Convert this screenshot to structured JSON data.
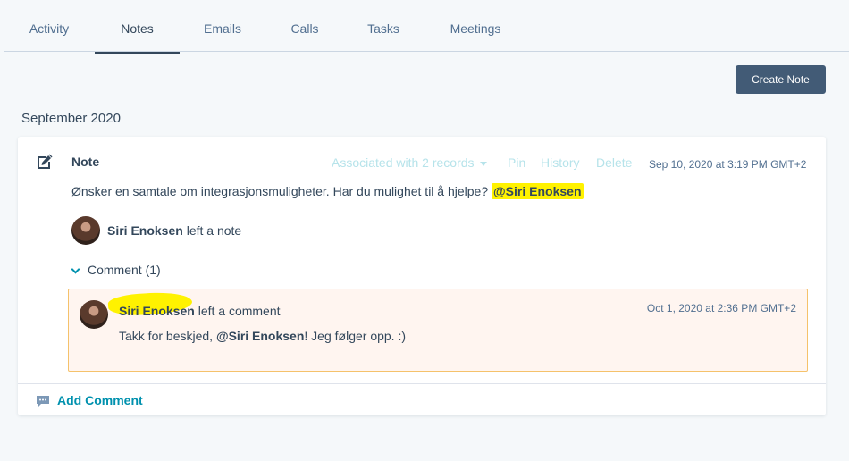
{
  "tabs": [
    {
      "label": "Activity"
    },
    {
      "label": "Notes"
    },
    {
      "label": "Emails"
    },
    {
      "label": "Calls"
    },
    {
      "label": "Tasks"
    },
    {
      "label": "Meetings"
    }
  ],
  "active_tab": "Notes",
  "create_button": "Create Note",
  "month": "September 2020",
  "note": {
    "title": "Note",
    "associated": "Associated with 2 records",
    "pin": "Pin",
    "history": "History",
    "delete": "Delete",
    "timestamp": "Sep 10, 2020 at 3:19 PM GMT+2",
    "body_text": "Ønsker en samtale om integrasjonsmuligheter. Har du mulighet til å hjelpe? ",
    "body_mention": "@Siri Enoksen",
    "author": "Siri Enoksen",
    "author_action": " left a note"
  },
  "comments": {
    "toggle_label": "Comment (1)",
    "item": {
      "author": "Siri Enoksen",
      "action": " left a comment",
      "timestamp": "Oct 1, 2020 at 2:36 PM GMT+2",
      "body_before": "Takk for beskjed, ",
      "body_mention": "@Siri Enoksen",
      "body_after": "! Jeg følger opp. :)"
    }
  },
  "add_comment": "Add Comment",
  "colors": {
    "accent": "#0091ae",
    "button": "#425b76",
    "highlight": "#fff200",
    "comment_bg": "#fff5f0"
  }
}
